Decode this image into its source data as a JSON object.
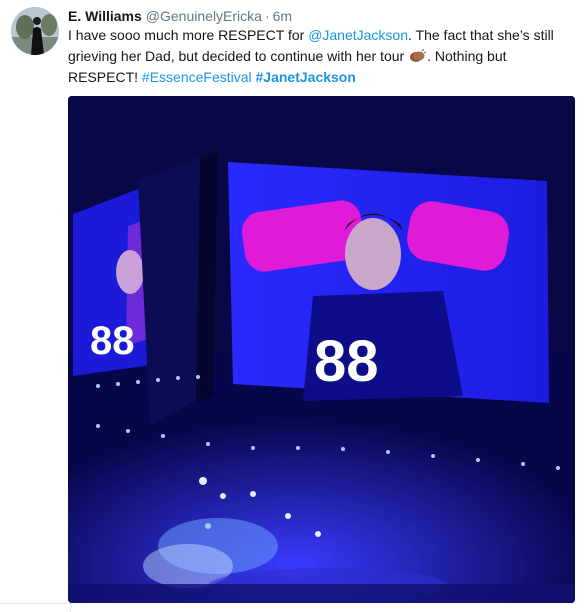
{
  "tweet": {
    "author_name": "E. Williams",
    "author_handle": "@GenuinelyEricka",
    "separator": "·",
    "timestamp": "6m",
    "text_before_mention": "I have sooo much more RESPECT for ",
    "mention": "@JanetJackson",
    "text_after_mention": ". The fact that she’s still grieving her Dad, but decided to continue with her tour ",
    "text_after_emoji": ". Nothing but RESPECT! ",
    "hashtag_1": "#EssenceFestival",
    "hashtag_2": "#JanetJackson",
    "emoji": "clapping-hands-emoji"
  },
  "media": {
    "jersey_number": "88",
    "jersey_number_left": "88"
  },
  "colors": {
    "link": "#1b95e0",
    "name": "#14171a",
    "meta": "#657786",
    "stage_blue": "#1a1aff"
  }
}
